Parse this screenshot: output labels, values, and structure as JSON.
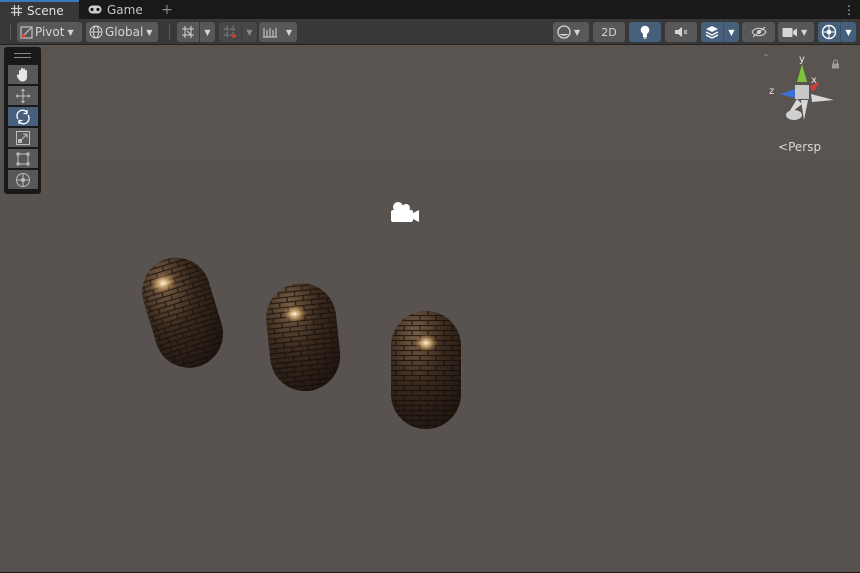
{
  "tabs": [
    {
      "label": "Scene",
      "icon": "grid-icon",
      "active": true
    },
    {
      "label": "Game",
      "icon": "gamepad-icon",
      "active": false
    }
  ],
  "toolbar": {
    "pivot_label": "Pivot",
    "global_label": "Global",
    "mode_2d_label": "2D"
  },
  "gizmo": {
    "axis_y": "y",
    "axis_x": "x",
    "axis_z": "z",
    "persp_label": "Persp",
    "persp_prefix": "<"
  },
  "colors": {
    "accent_active": "#46607c",
    "viewport_bg": "#585250",
    "axis_x": "#d63b3b",
    "axis_y": "#7cc23c",
    "axis_z": "#3a6fd6"
  }
}
